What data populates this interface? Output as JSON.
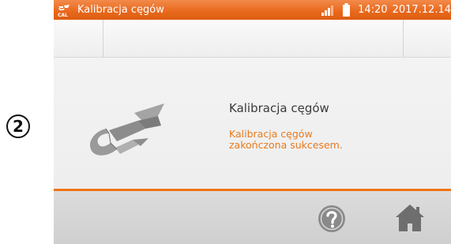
{
  "annotation": {
    "step_number": "2"
  },
  "status_bar": {
    "app_icon": "clamp-cal-icon",
    "title": "Kalibracja cęgów",
    "time": "14:20",
    "date": "2017.12.14",
    "signal_icon": "signal-strength-icon",
    "battery_icon": "battery-icon"
  },
  "message": {
    "icon": "current-clamp-icon",
    "title": "Kalibracja cęgów",
    "body_line1": "Kalibracja cęgów",
    "body_line2": "zakończona sukcesem."
  },
  "bottom_bar": {
    "help_icon": "help-icon",
    "home_icon": "home-icon"
  },
  "colors": {
    "accent": "#e8681c",
    "message_text": "#e87a1e",
    "title_text": "#3a3a3a",
    "icon_gray": "#8a8a8a"
  }
}
